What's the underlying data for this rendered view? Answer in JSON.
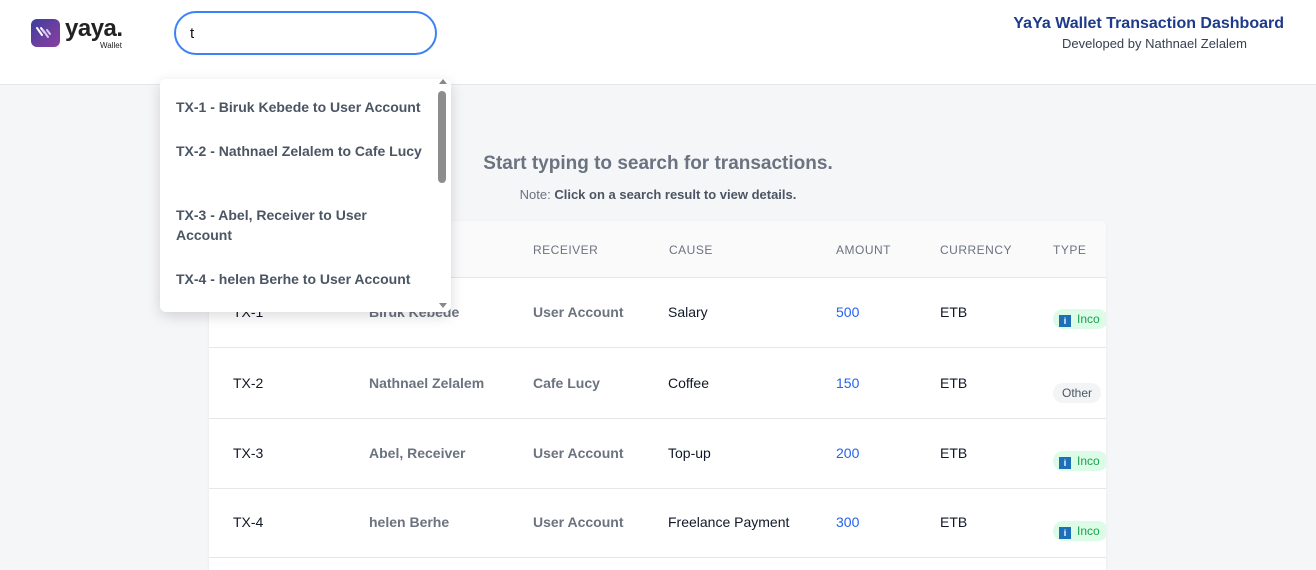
{
  "header": {
    "logo_text": "yaya.",
    "logo_sub": "Wallet",
    "search_value": "t",
    "title": "YaYa Wallet Transaction Dashboard",
    "subtitle": "Developed by Nathnael Zelalem"
  },
  "main": {
    "hint": "Start typing to search for transactions.",
    "note_prefix": "Note:",
    "note_text": "Click on a search result to view details."
  },
  "table": {
    "headers": {
      "receiver": "RECEIVER",
      "cause": "CAUSE",
      "amount": "AMOUNT",
      "currency": "CURRENCY",
      "type": "TYPE"
    },
    "rows": [
      {
        "id": "TX-1",
        "sender": "Biruk Kebede",
        "receiver": "User Account",
        "cause": "Salary",
        "amount": "500",
        "currency": "ETB",
        "type": "Inco"
      },
      {
        "id": "TX-2",
        "sender": "Nathnael Zelalem",
        "receiver": "Cafe Lucy",
        "cause": "Coffee",
        "amount": "150",
        "currency": "ETB",
        "type": "Other"
      },
      {
        "id": "TX-3",
        "sender": "Abel, Receiver",
        "receiver": "User Account",
        "cause": "Top-up",
        "amount": "200",
        "currency": "ETB",
        "type": "Inco"
      },
      {
        "id": "TX-4",
        "sender": "helen Berhe",
        "receiver": "User Account",
        "cause": "Freelance Payment",
        "amount": "300",
        "currency": "ETB",
        "type": "Inco"
      }
    ]
  },
  "dropdown": {
    "items": [
      {
        "label": "TX-1 - Biruk Kebede to User Account"
      },
      {
        "label": "TX-2 - Nathnael Zelalem to Cafe Lucy"
      },
      {
        "label": "TX-3 - Abel, Receiver to User Account"
      },
      {
        "label": "TX-4 - helen Berhe to User Account"
      }
    ]
  },
  "colors": {
    "accent": "#3b82f6",
    "title": "#1e3a8a",
    "amount": "#2563eb",
    "incoming_badge_bg": "#dcfce7",
    "incoming_badge_text": "#16a34a",
    "info_icon": "#1d6fb8"
  }
}
